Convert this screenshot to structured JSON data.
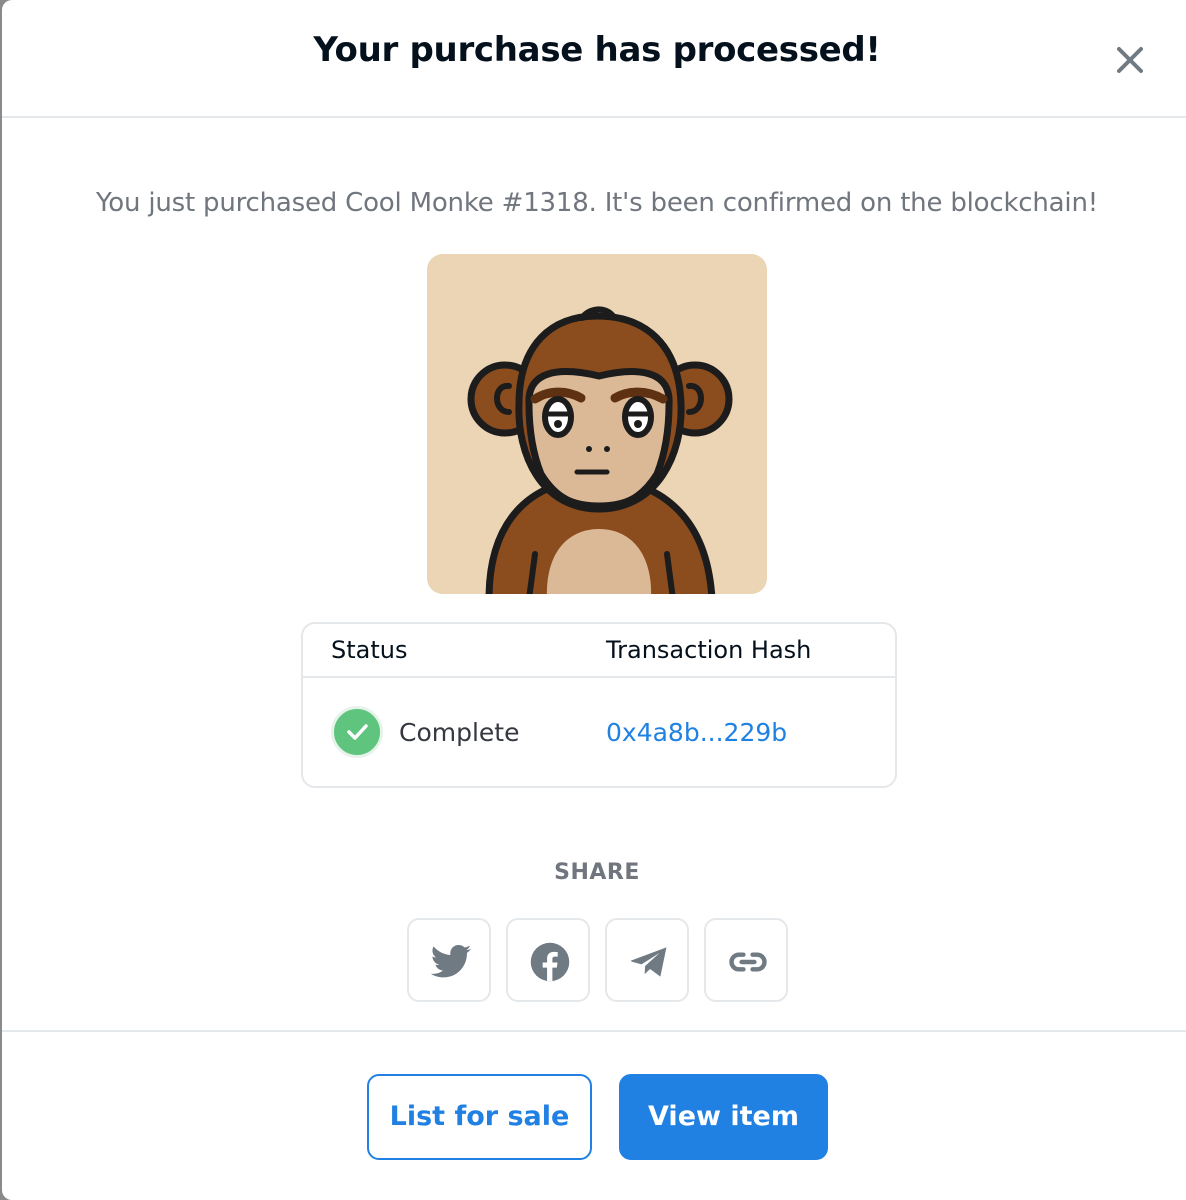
{
  "modal": {
    "title": "Your purchase has processed!",
    "subtitle": "You just purchased Cool Monke #1318. It's been confirmed on the blockchain!"
  },
  "transaction": {
    "headers": {
      "status": "Status",
      "hash": "Transaction Hash"
    },
    "status_value": "Complete",
    "hash_value": "0x4a8b...229b"
  },
  "share": {
    "label": "SHARE",
    "buttons": [
      {
        "icon": "twitter-icon"
      },
      {
        "icon": "facebook-icon"
      },
      {
        "icon": "telegram-icon"
      },
      {
        "icon": "link-icon"
      }
    ]
  },
  "footer": {
    "list_for_sale_label": "List for sale",
    "view_item_label": "View item"
  },
  "colors": {
    "accent": "#2081e2",
    "success": "#5fc47e",
    "nft_background": "#ecd5b5",
    "monkey_fur": "#8b4c1e"
  }
}
